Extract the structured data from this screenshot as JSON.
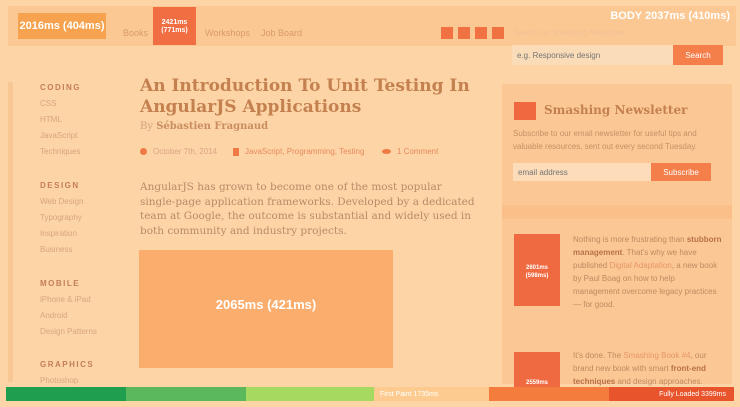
{
  "header": {
    "timing_badge": "2016ms (404ms)",
    "body_timing": "BODY 2037ms (410ms)",
    "nav": {
      "books": "Books",
      "workshops": "Workshops",
      "job_board": "Job Board",
      "timing_line1": "2421ms",
      "timing_line2": "(771ms)"
    },
    "search": {
      "caption": "Search on Smashing Magazine",
      "placeholder": "e.g. Responsive design",
      "button": "Search"
    }
  },
  "sidebar": {
    "categories": [
      {
        "heading": "CODING",
        "links": [
          "CSS",
          "HTML",
          "JavaScript",
          "Techniques"
        ]
      },
      {
        "heading": "DESIGN",
        "links": [
          "Web Design",
          "Typography",
          "Inspiration",
          "Business"
        ]
      },
      {
        "heading": "MOBILE",
        "links": [
          "iPhone & iPad",
          "Android",
          "Design Patterns"
        ]
      },
      {
        "heading": "GRAPHICS",
        "links": [
          "Photoshop"
        ]
      }
    ]
  },
  "article": {
    "title": "An Introduction To Unit Testing In AngularJS Applications",
    "by": "By",
    "author": "Sébastien Fragnaud",
    "date": "October 7th, 2014",
    "tags": "JavaScript, Programming, Testing",
    "comments": "1 Comment",
    "intro": "AngularJS has grown to become one of the most popular single-page application frameworks. Developed by a dedicated team at Google, the outcome is substantial and widely used in both community and industry projects.",
    "hero_timing": "2065ms (421ms)"
  },
  "newsletter": {
    "title": "Smashing Newsletter",
    "text": "Subscribe to our email newsletter for useful tips and valuable resources, sent out every second Tuesday.",
    "placeholder": "email address",
    "button": "Subscribe"
  },
  "promos": [
    {
      "timing_line1": "2601ms",
      "timing_line2": "(598ms)",
      "t1": "Nothing is more frustrating than ",
      "b1": "stubborn management",
      "t2": ". That's why we have published ",
      "link": "Digital Adaptation",
      "t3": ", a new book by Paul Boag on how to help management overcome legacy practices — for good."
    },
    {
      "timing": "2559ms",
      "t1": "It's done. The ",
      "link": "Smashing Book #4",
      "t2": ", our brand new book with smart ",
      "b1": "front-end techniques",
      "t3": " and design approaches."
    }
  ],
  "timeline": {
    "first_paint": "First Paint 1735ms",
    "fully_loaded": "Fully Loaded 3399ms",
    "colors": [
      "#1f9e4f",
      "#5cb85c",
      "#a6d95f",
      "#fdcb8f",
      "#f47c3c",
      "#e8542b",
      "#d43325"
    ]
  }
}
